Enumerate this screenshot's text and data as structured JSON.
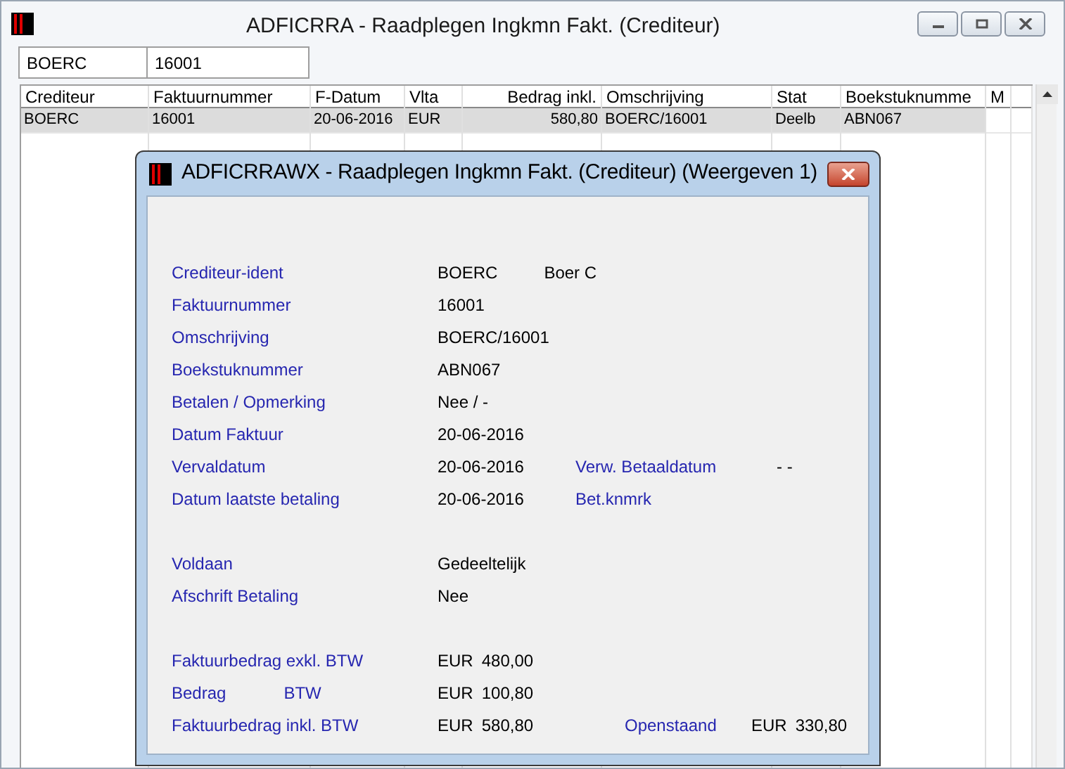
{
  "window": {
    "title": "ADFICRRA - Raadplegen Ingkmn Fakt. (Crediteur)"
  },
  "filters": [
    {
      "value": "BOERC"
    },
    {
      "value": "16001"
    }
  ],
  "table": {
    "columns": [
      "Crediteur",
      "Faktuurnummer",
      "F-Datum",
      "Vlta",
      "Bedrag inkl.",
      "Omschrijving",
      "Stat",
      "Boekstuknumme",
      "M"
    ],
    "rows": [
      {
        "selected": true,
        "cells": [
          "BOERC",
          "16001",
          "20-06-2016",
          "EUR",
          "580,80",
          "BOERC/16001",
          "Deelb",
          "ABN067"
        ]
      }
    ]
  },
  "dialog": {
    "title": "ADFICRRAWX - Raadplegen Ingkmn Fakt. (Crediteur) (Weergeven 1)",
    "sections": [
      [
        {
          "label": "Crediteur-ident",
          "values": [
            "BOERC",
            "Boer C"
          ]
        },
        {
          "label": "Faktuurnummer",
          "values": [
            "16001"
          ]
        },
        {
          "label": "Omschrijving",
          "values": [
            "BOERC/16001"
          ]
        },
        {
          "label": "Boekstuknummer",
          "values": [
            "ABN067"
          ]
        },
        {
          "label": "Betalen / Opmerking",
          "values": [
            "Nee / -"
          ]
        },
        {
          "label": "Datum Faktuur",
          "values": [
            "20-06-2016"
          ]
        },
        {
          "label": "Vervaldatum",
          "values": [
            "20-06-2016"
          ],
          "extra": {
            "kind": "date",
            "label": "Verw. Betaaldatum",
            "values": [
              "- -"
            ]
          }
        },
        {
          "label": "Datum laatste betaling",
          "values": [
            "20-06-2016"
          ],
          "extra": {
            "kind": "date",
            "label": "Bet.knmrk"
          }
        }
      ],
      [
        {
          "label": "Voldaan",
          "values": [
            "Gedeeltelijk"
          ]
        },
        {
          "label": "Afschrift Betaling",
          "values": [
            "Nee"
          ]
        }
      ],
      [
        {
          "label": "Faktuurbedrag exkl. BTW",
          "values": [
            "EUR",
            "480,00"
          ]
        },
        {
          "label": "Bedrag",
          "label_suffix": "BTW",
          "values": [
            "EUR",
            "100,80"
          ]
        },
        {
          "label": "Faktuurbedrag inkl. BTW",
          "values": [
            "EUR",
            "580,80"
          ],
          "extra": {
            "kind": "total",
            "label": "Openstaand",
            "values": [
              "EUR",
              "330,80"
            ]
          }
        }
      ]
    ]
  }
}
